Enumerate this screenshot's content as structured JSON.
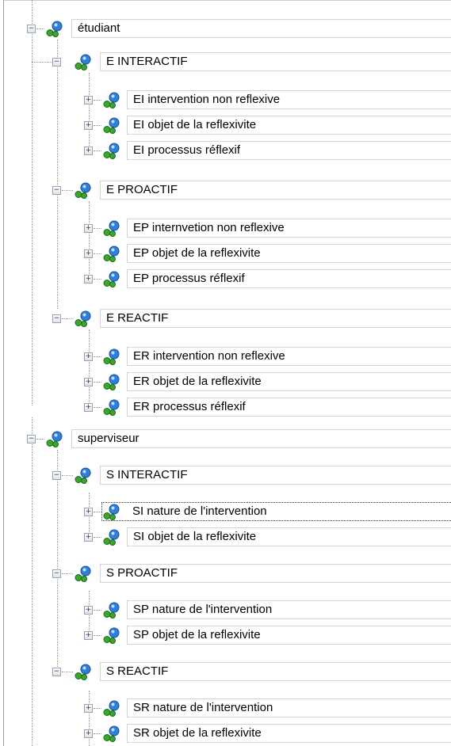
{
  "tree": {
    "etudiant": {
      "label": "étudiant",
      "groups": {
        "interactif": {
          "label": "E INTERACTIF",
          "items": [
            "EI intervention non reflexive",
            "EI objet de la reflexivite",
            "EI processus réflexif"
          ]
        },
        "proactif": {
          "label": "E PROACTIF",
          "items": [
            "EP internvetion non reflexive",
            "EP objet de la reflexivite",
            "EP processus réflexif"
          ]
        },
        "reactif": {
          "label": "E REACTIF",
          "items": [
            "ER intervention non reflexive",
            "ER objet de la reflexivite",
            "ER processus réflexif"
          ]
        }
      }
    },
    "superviseur": {
      "label": "superviseur",
      "groups": {
        "interactif": {
          "label": "S INTERACTIF",
          "items": [
            "SI nature de l'intervention",
            "SI objet de la reflexivite"
          ]
        },
        "proactif": {
          "label": "S PROACTIF",
          "items": [
            "SP nature de l'intervention",
            "SP objet de la reflexivite"
          ]
        },
        "reactif": {
          "label": "S REACTIF",
          "items": [
            "SR nature de l'intervention",
            "SR objet de la reflexivite"
          ]
        }
      }
    },
    "expander_symbols": {
      "collapse": "−",
      "expand": "+"
    },
    "node_icon": "node-network-icon",
    "colors": {
      "icon_blue": "#2f7fd8",
      "icon_green": "#3aa62e",
      "lines": "#9a9a9a",
      "box_border": "#d4d4d4"
    }
  }
}
